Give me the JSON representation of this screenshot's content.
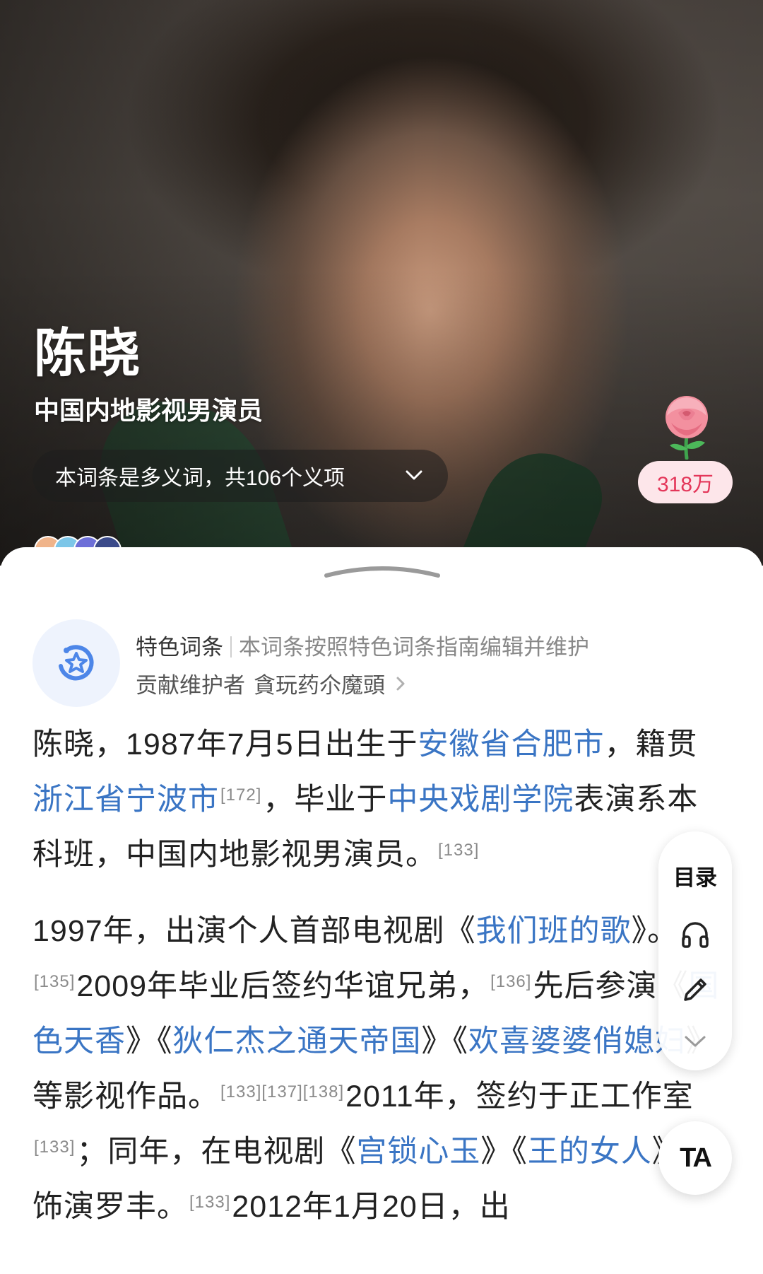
{
  "header": {
    "name": "陈晓",
    "subtitle": "中国内地影视男演员",
    "polysemy_text": "本词条是多义词，共106个义项",
    "flower_count": "318万"
  },
  "feature": {
    "title": "特色词条",
    "description": "本词条按照特色词条指南编辑并维护",
    "contributor_prefix": "贡献维护者",
    "contributor_name": "貪玩药尒魔頭"
  },
  "article": {
    "p1": [
      {
        "t": "text",
        "v": "陈晓，1987年7月5日出生于"
      },
      {
        "t": "link",
        "v": "安徽省合肥市"
      },
      {
        "t": "text",
        "v": "，籍贯"
      },
      {
        "t": "link",
        "v": "浙江省宁波市"
      },
      {
        "t": "ref",
        "v": "[172]"
      },
      {
        "t": "text",
        "v": "，毕业于"
      },
      {
        "t": "link",
        "v": "中央戏剧学院"
      },
      {
        "t": "text",
        "v": "表演系本科班，中国内地影视男演员。"
      },
      {
        "t": "ref",
        "v": "[133]"
      }
    ],
    "p2": [
      {
        "t": "text",
        "v": "1997年，出演个人首部电视剧《"
      },
      {
        "t": "link",
        "v": "我们班的歌"
      },
      {
        "t": "text",
        "v": "》。"
      },
      {
        "t": "ref",
        "v": "[135]"
      },
      {
        "t": "text",
        "v": "2009年毕业后签约华谊兄弟，"
      },
      {
        "t": "ref",
        "v": "[136]"
      },
      {
        "t": "text",
        "v": "先后参演《"
      },
      {
        "t": "link",
        "v": "国色天香"
      },
      {
        "t": "text",
        "v": "》《"
      },
      {
        "t": "link",
        "v": "狄仁杰之通天帝国"
      },
      {
        "t": "text",
        "v": "》《"
      },
      {
        "t": "link",
        "v": "欢喜婆婆俏媳妇"
      },
      {
        "t": "text",
        "v": "》等影视作品。"
      },
      {
        "t": "ref",
        "v": "[133][137][138]"
      },
      {
        "t": "text",
        "v": "2011年，签约于正工作室"
      },
      {
        "t": "ref",
        "v": "[133]"
      },
      {
        "t": "text",
        "v": "；同年，在电视剧《"
      },
      {
        "t": "link",
        "v": "宫锁心玉"
      },
      {
        "t": "text",
        "v": "》《"
      },
      {
        "t": "link",
        "v": "王的女人"
      },
      {
        "t": "text",
        "v": "》中饰演罗丰。"
      },
      {
        "t": "ref",
        "v": "[133]"
      },
      {
        "t": "text",
        "v": "2012年1月20日，出"
      }
    ]
  },
  "toolbar": {
    "toc_label": "目录",
    "ta_label": "TA"
  },
  "icons": {
    "polysemy_chevron": "chevron-down-icon",
    "flower": "rose-icon",
    "feature_badge": "star-badge-icon",
    "contributor_chevron": "chevron-right-icon",
    "listen": "headphones-icon",
    "edit": "pencil-icon",
    "collapse": "chevron-down-icon"
  },
  "colors": {
    "link": "#3a75c4",
    "flower_count_text": "#e4375a",
    "flower_count_bg": "#fde6ea",
    "badge_bg": "#eef3fd",
    "badge_icon": "#4d86e8"
  }
}
